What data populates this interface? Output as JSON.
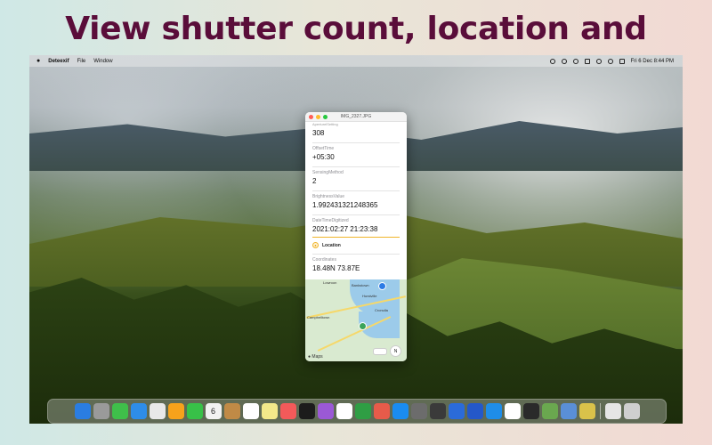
{
  "headline": "View shutter count, location and more...",
  "menubar": {
    "app_name": "Deteexif",
    "menus": [
      "File",
      "Window"
    ],
    "clock": "Fri 6 Dec  8:44 PM"
  },
  "window": {
    "title": "IMG_2327.JPG",
    "cut_label": "AperturelSetting",
    "fields": [
      {
        "label": "",
        "value": "308"
      },
      {
        "label": "OffsetTime",
        "value": "+05:30"
      },
      {
        "label": "SensingMethod",
        "value": "2"
      },
      {
        "label": "BrightnessValue",
        "value": "1.992431321248365"
      },
      {
        "label": "DateTimeDigitized",
        "value": "2021:02:27 21:23:38"
      }
    ],
    "location_section": {
      "title": "Location",
      "coordinates_label": "Coordinates",
      "coordinates_value": "18.48N 73.87E"
    },
    "map": {
      "labels": [
        "Lowroon",
        "Bankstown",
        "Hurstville",
        "Cronulla",
        "Campbelltown"
      ],
      "logo": "Maps",
      "compass": "N"
    }
  },
  "dock": {
    "colors": [
      "#2a7de1",
      "#9a9a9a",
      "#3fbf4a",
      "#2e8de8",
      "#e8e8e8",
      "#f7a21b",
      "#38c148",
      "#f2f2f2",
      "#c08a46",
      "#ffffff",
      "#f3e98a",
      "#f25a5a",
      "#1c1c1c",
      "#9b59d6",
      "#ffffff",
      "#2f9e44",
      "#e75b4a",
      "#1a8cf0",
      "#6c6c6c",
      "#3a3a3a",
      "#2b6bd9",
      "#2458c9",
      "#1f8de8",
      "#ffffff",
      "#2a2a2a",
      "#6aa84f",
      "#5a8fd6",
      "#d9c24a",
      "#e5e5e5",
      "#cfcfcf"
    ],
    "names": [
      "finder-icon",
      "launchpad-icon",
      "messages-icon",
      "mail-icon",
      "maps-icon",
      "photos-icon",
      "facetime-icon",
      "calendar-icon",
      "contacts-icon",
      "reminders-icon",
      "notes-icon",
      "freeform-icon",
      "tv-icon",
      "podcasts-icon",
      "preview-icon",
      "numbers-icon",
      "pages-icon",
      "app-store-icon",
      "settings-icon",
      "mission-control-icon",
      "xcode-icon",
      "vscode-icon",
      "safari-icon",
      "gmail-icon",
      "terminal-icon",
      "app-icon",
      "app-icon-2",
      "app-icon-3",
      "downloads-icon",
      "trash-icon"
    ],
    "calendar_day": "6"
  }
}
